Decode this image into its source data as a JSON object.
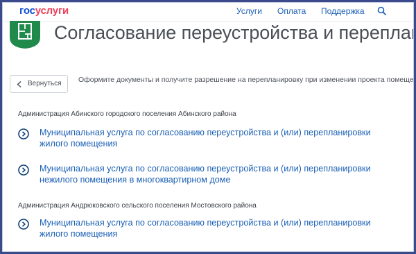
{
  "header": {
    "logo_part1": "гос",
    "logo_part2": "услуги",
    "nav": [
      {
        "label": "Услуги"
      },
      {
        "label": "Оплата"
      },
      {
        "label": "Поддержка"
      }
    ],
    "search_icon": "search-icon"
  },
  "page": {
    "title": "Согласование переустройства и перепланировки",
    "icon": "floor-plan-icon"
  },
  "back_button": {
    "label": "Вернуться",
    "icon": "chevron-left-icon"
  },
  "subtitle": "Оформите документы и получите разрешение на перепланировку при изменении проекта помещения",
  "sections": [
    {
      "org": "Администрация Абинского городского поселения Абинского района",
      "services": [
        {
          "title": "Муниципальная услуга по согласованию переустройства и (или) перепланировки жилого помещения"
        },
        {
          "title": "Муниципальная услуга по согласованию переустройства и (или) перепланировки нежилого помещения в многоквартирном доме"
        }
      ]
    },
    {
      "org": "Администрация Андрюковского сельского поселения Мостовского района",
      "services": [
        {
          "title": "Муниципальная услуга по согласованию переустройства и (или) перепланировки жилого помещения"
        }
      ]
    }
  ],
  "colors": {
    "brand_blue": "#0d4cd3",
    "brand_red": "#ee3f58",
    "link": "#1a5fb4",
    "icon_green": "#1f8a4c"
  }
}
